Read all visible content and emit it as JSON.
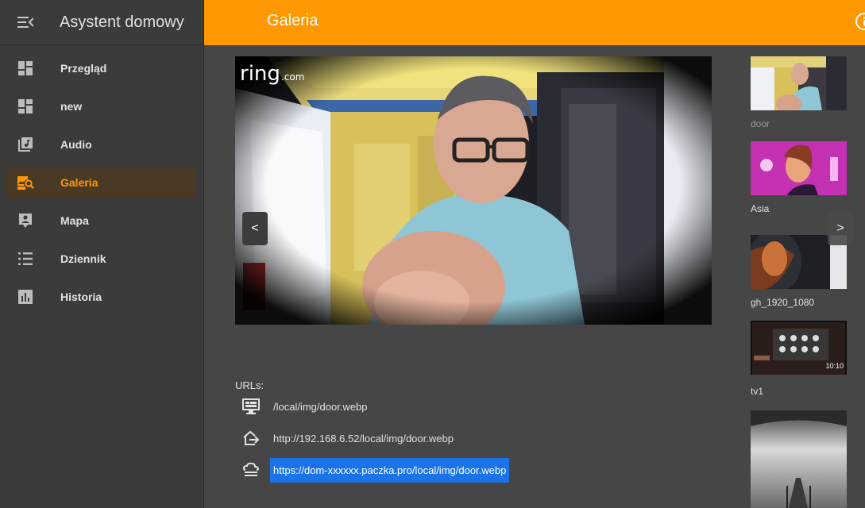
{
  "sidebar": {
    "title": "Asystent domowy",
    "items": [
      {
        "label": "Przegląd",
        "icon": "dashboard-icon"
      },
      {
        "label": "new",
        "icon": "dashboard-icon"
      },
      {
        "label": "Audio",
        "icon": "music-library-icon"
      },
      {
        "label": "Galeria",
        "icon": "image-search-icon",
        "active": true
      },
      {
        "label": "Mapa",
        "icon": "map-account-icon"
      },
      {
        "label": "Dziennik",
        "icon": "list-icon"
      },
      {
        "label": "Historia",
        "icon": "chart-bar-icon"
      }
    ]
  },
  "header": {
    "title": "Galeria",
    "accent": "#ff9800"
  },
  "viewer": {
    "watermark": "ring",
    "watermark_suffix": ".com",
    "prev_label": "<",
    "next_label": ">"
  },
  "urls": {
    "label": "URLs:",
    "items": [
      {
        "icon": "monitor-icon",
        "text": "/local/img/door.webp"
      },
      {
        "icon": "home-export-icon",
        "text": "http://192.168.6.52/local/img/door.webp"
      },
      {
        "icon": "cloud-icon",
        "text": "https://dom-xxxxxx.paczka.pro/local/img/door.webp",
        "selected": true
      }
    ]
  },
  "thumbnails": [
    {
      "caption": "door",
      "dim": true
    },
    {
      "caption": "Asia"
    },
    {
      "caption": "gh_1920_1080"
    },
    {
      "caption": "tv1",
      "clock": "10:10"
    },
    {
      "caption": ""
    }
  ]
}
